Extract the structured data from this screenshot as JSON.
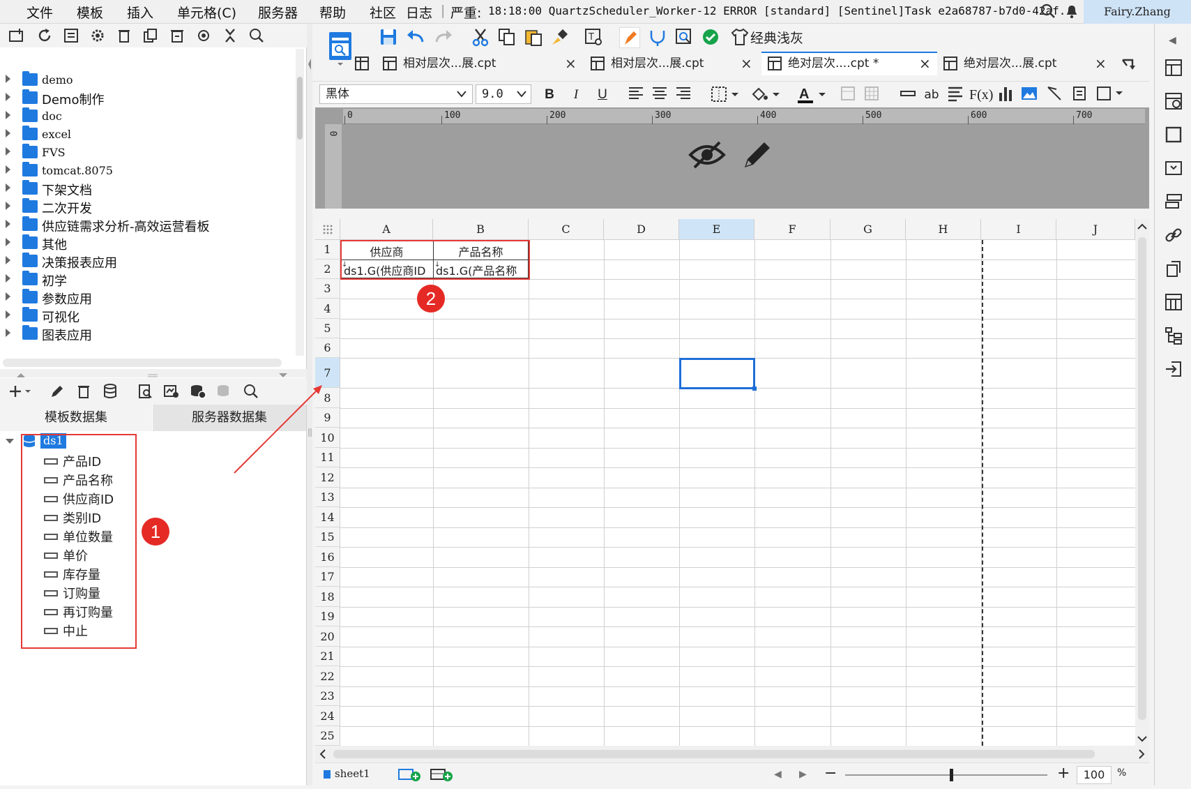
{
  "menubar": {
    "items": [
      "文件",
      "模板",
      "插入",
      "单元格(C)",
      "服务器",
      "帮助",
      "社区",
      "日志"
    ],
    "log_prefix": "严重:",
    "log_text": "18:18:00 QuartzScheduler_Worker-12 ERROR [standard] [Sentinel]Task e2a68787-b7d0-42af...",
    "user": "Fairy.Zhang"
  },
  "file_tree": [
    "demo",
    "Demo制作",
    "doc",
    "excel",
    "FVS",
    "tomcat.8075",
    "下架文档",
    "二次开发",
    "供应链需求分析-高效运营看板",
    "其他",
    "决策报表应用",
    "初学",
    "参数应用",
    "可视化",
    "图表应用"
  ],
  "dataset_tabs": {
    "template": "模板数据集",
    "server": "服务器数据集"
  },
  "dataset": {
    "name": "ds1",
    "fields": [
      "产品ID",
      "产品名称",
      "供应商ID",
      "类别ID",
      "单位数量",
      "单价",
      "库存量",
      "订购量",
      "再订购量",
      "中止"
    ]
  },
  "toolbar": {
    "theme_label": "经典浅灰"
  },
  "doc_tabs": [
    {
      "label": "相对层次...展.cpt"
    },
    {
      "label": "相对层次...展.cpt"
    },
    {
      "label": "绝对层次....cpt *"
    },
    {
      "label": "绝对层次...展.cpt"
    }
  ],
  "format": {
    "font": "黑体",
    "size": "9.0"
  },
  "ruler": [
    "0",
    "100",
    "200",
    "300",
    "400",
    "500",
    "600",
    "700"
  ],
  "ruler_left": "0",
  "sheet": {
    "columns": [
      "A",
      "B",
      "C",
      "D",
      "E",
      "F",
      "G",
      "H",
      "I",
      "J"
    ],
    "selected_column": "E",
    "selected_row": 7,
    "rows": [
      "1",
      "2",
      "3",
      "4",
      "5",
      "6",
      "7",
      "8",
      "9",
      "10",
      "11",
      "12",
      "13",
      "14",
      "15",
      "16",
      "17",
      "18",
      "19",
      "20",
      "21",
      "22",
      "23",
      "24",
      "25"
    ],
    "cells": {
      "A1": "供应商",
      "B1": "产品名称",
      "A2": "ds1.G(供应商ID",
      "B2": "ds1.G(产品名称"
    }
  },
  "badges": {
    "one": "1",
    "two": "2"
  },
  "status": {
    "sheet_name": "sheet1",
    "zoom": "100",
    "zoom_unit": "%"
  },
  "colors": {
    "accent_blue": "#1f7ae0",
    "red": "#e53935",
    "badge": "#e52a25",
    "selection": "#1e6fd9"
  }
}
